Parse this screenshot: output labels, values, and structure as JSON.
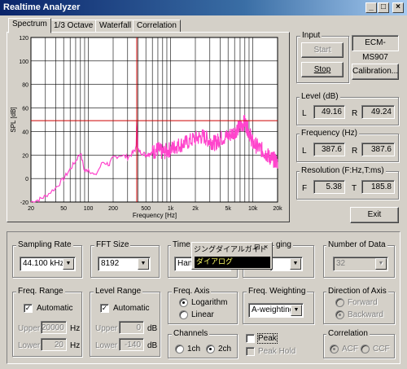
{
  "window": {
    "title": "Realtime Analyzer",
    "min_glyph": "_",
    "max_glyph": "□",
    "close_glyph": "×"
  },
  "tabs": [
    "Spectrum",
    "1/3 Octave",
    "Waterfall",
    "Correlation"
  ],
  "chart_data": {
    "type": "line",
    "xlabel": "Frequency [Hz]",
    "ylabel": "SPL [dB]",
    "xscale": "log",
    "xlim": [
      20,
      20000
    ],
    "ylim": [
      -20,
      120
    ],
    "y_ticks": [
      -20,
      0,
      20,
      40,
      60,
      80,
      100,
      120
    ],
    "x_ticks": [
      "20",
      "50",
      "100",
      "200",
      "500",
      "1k",
      "2k",
      "5k",
      "10k",
      "20k"
    ],
    "x_tick_values": [
      20,
      50,
      100,
      200,
      500,
      1000,
      2000,
      5000,
      10000,
      20000
    ],
    "grid": true,
    "cursor_x_hz": 387.6,
    "cursor_y_db": 49.2,
    "series": [
      {
        "color": "#ff44cc",
        "x": [
          20,
          25,
          30,
          40,
          50,
          60,
          70,
          80,
          90,
          100,
          120,
          150,
          180,
          200,
          250,
          300,
          350,
          380,
          387.6,
          400,
          450,
          500,
          600,
          700,
          800,
          1000,
          1200,
          1500,
          2000,
          2500,
          3000,
          3500,
          4000,
          5000,
          6000,
          7000,
          8000,
          9000,
          10000,
          12000,
          14000,
          16000,
          18000,
          20000
        ],
        "y": [
          -20,
          -18,
          -15,
          -8,
          0,
          8,
          15,
          22,
          6,
          8,
          2,
          14,
          12,
          18,
          20,
          18,
          22,
          26,
          49,
          24,
          22,
          20,
          22,
          25,
          22,
          25,
          28,
          30,
          34,
          36,
          32,
          30,
          34,
          36,
          40,
          44,
          48,
          40,
          30,
          26,
          22,
          18,
          16,
          14
        ]
      }
    ]
  },
  "input": {
    "label": "Input",
    "start": "Start",
    "stop": "Stop",
    "device": "ECM-MS907",
    "calibration": "Calibration..."
  },
  "level": {
    "label": "Level (dB)",
    "l_label": "L",
    "l_value": "49.16",
    "r_label": "R",
    "r_value": "49.24"
  },
  "frequency": {
    "label": "Frequency (Hz)",
    "l_label": "L",
    "l_value": "387.6",
    "r_label": "R",
    "r_value": "387.6"
  },
  "resolution": {
    "label": "Resolution (F:Hz,T:ms)",
    "f_label": "F",
    "f_value": "5.38",
    "t_label": "T",
    "t_value": "185.8"
  },
  "exit": "Exit",
  "sampling_rate": {
    "label": "Sampling Rate",
    "value": "44.100 kHz"
  },
  "fft_size": {
    "label": "FFT Size",
    "value": "8192"
  },
  "time_window": {
    "label": "Time",
    "value": "Han"
  },
  "averaging": {
    "label": "ging"
  },
  "number_of_data": {
    "label": "Number of Data",
    "value": "32"
  },
  "ime": {
    "title": "ジングダイアルガイド",
    "text": "ダイアログ"
  },
  "freq_range": {
    "label": "Freq. Range",
    "automatic": "Automatic",
    "upper_label": "Upper",
    "upper_value": "20000",
    "upper_unit": "Hz",
    "lower_label": "Lower",
    "lower_value": "20",
    "lower_unit": "Hz"
  },
  "level_range": {
    "label": "Level Range",
    "automatic": "Automatic",
    "upper_label": "Upper",
    "upper_value": "0",
    "upper_unit": "dB",
    "lower_label": "Lower",
    "lower_value": "-140",
    "lower_unit": "dB"
  },
  "freq_axis": {
    "label": "Freq. Axis",
    "logarithm": "Logarithm",
    "linear": "Linear"
  },
  "freq_weighting": {
    "label": "Freq. Weighting",
    "value": "A-weighting"
  },
  "direction": {
    "label": "Direction of Axis",
    "forward": "Forward",
    "backward": "Backward"
  },
  "channels": {
    "label": "Channels",
    "ch1": "1ch",
    "ch2": "2ch"
  },
  "peak": {
    "peak": "Peak",
    "peak_hold": "Peak Hold"
  },
  "correlation": {
    "label": "Correlation",
    "acf": "ACF",
    "ccf": "CCF"
  }
}
